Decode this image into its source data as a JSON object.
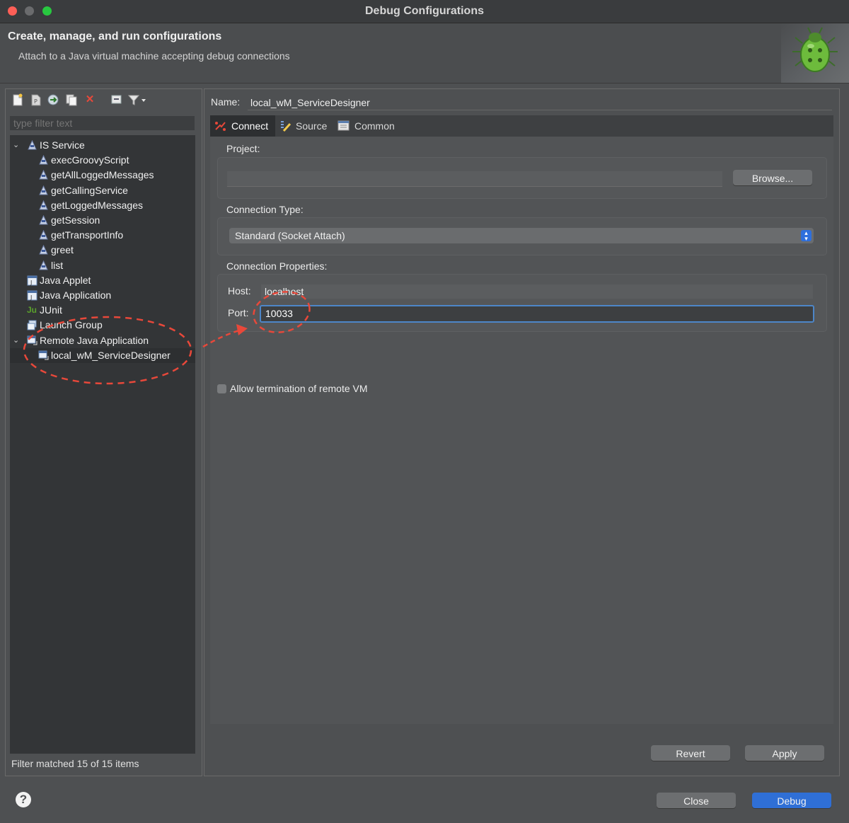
{
  "window": {
    "title": "Debug Configurations"
  },
  "header": {
    "title": "Create, manage, and run configurations",
    "subtitle": "Attach to a Java virtual machine accepting debug connections"
  },
  "icons": {
    "new": "new-config-icon",
    "new_proto": "new-prototype-icon",
    "export": "export-icon",
    "duplicate": "duplicate-icon",
    "delete": "delete-icon",
    "collapse": "collapse-all-icon",
    "filter": "filter-icon"
  },
  "sidebar": {
    "filter_placeholder": "type filter text",
    "tree": [
      {
        "label": "IS Service",
        "depth": 0,
        "expanded": true
      },
      {
        "label": "execGroovyScript",
        "depth": 1
      },
      {
        "label": "getAllLoggedMessages",
        "depth": 1
      },
      {
        "label": "getCallingService",
        "depth": 1
      },
      {
        "label": "getLoggedMessages",
        "depth": 1
      },
      {
        "label": "getSession",
        "depth": 1
      },
      {
        "label": "getTransportInfo",
        "depth": 1
      },
      {
        "label": "greet",
        "depth": 1
      },
      {
        "label": "list",
        "depth": 1
      },
      {
        "label": "Java Applet",
        "depth": 0
      },
      {
        "label": "Java Application",
        "depth": 0
      },
      {
        "label": "JUnit",
        "depth": 0,
        "prefix": "Ju"
      },
      {
        "label": "Launch Group",
        "depth": 0
      },
      {
        "label": "Remote Java Application",
        "depth": 0,
        "expanded": true
      },
      {
        "label": "local_wM_ServiceDesigner",
        "depth": 1,
        "selected": true
      }
    ],
    "status": "Filter matched 15 of 15 items"
  },
  "config": {
    "name_label": "Name:",
    "name_value": "local_wM_ServiceDesigner",
    "tabs": [
      {
        "label": "Connect",
        "icon": "connect-icon",
        "active": true
      },
      {
        "label": "Source",
        "icon": "source-icon"
      },
      {
        "label": "Common",
        "icon": "common-icon"
      }
    ],
    "project_label": "Project:",
    "project_value": "",
    "browse_label": "Browse...",
    "connection_type_label": "Connection Type:",
    "connection_type_value": "Standard (Socket Attach)",
    "connection_props_label": "Connection Properties:",
    "host_label": "Host:",
    "host_value": "localhost",
    "port_label": "Port:",
    "port_value": "10033",
    "allow_termination_label": "Allow termination of remote VM",
    "allow_termination_checked": false,
    "revert_label": "Revert",
    "apply_label": "Apply"
  },
  "footer": {
    "help_symbol": "?",
    "close_label": "Close",
    "debug_label": "Debug"
  },
  "colors": {
    "annotation": "#e8483a",
    "primary_button": "#2f6fd6",
    "focus_border": "#4d86c8"
  }
}
